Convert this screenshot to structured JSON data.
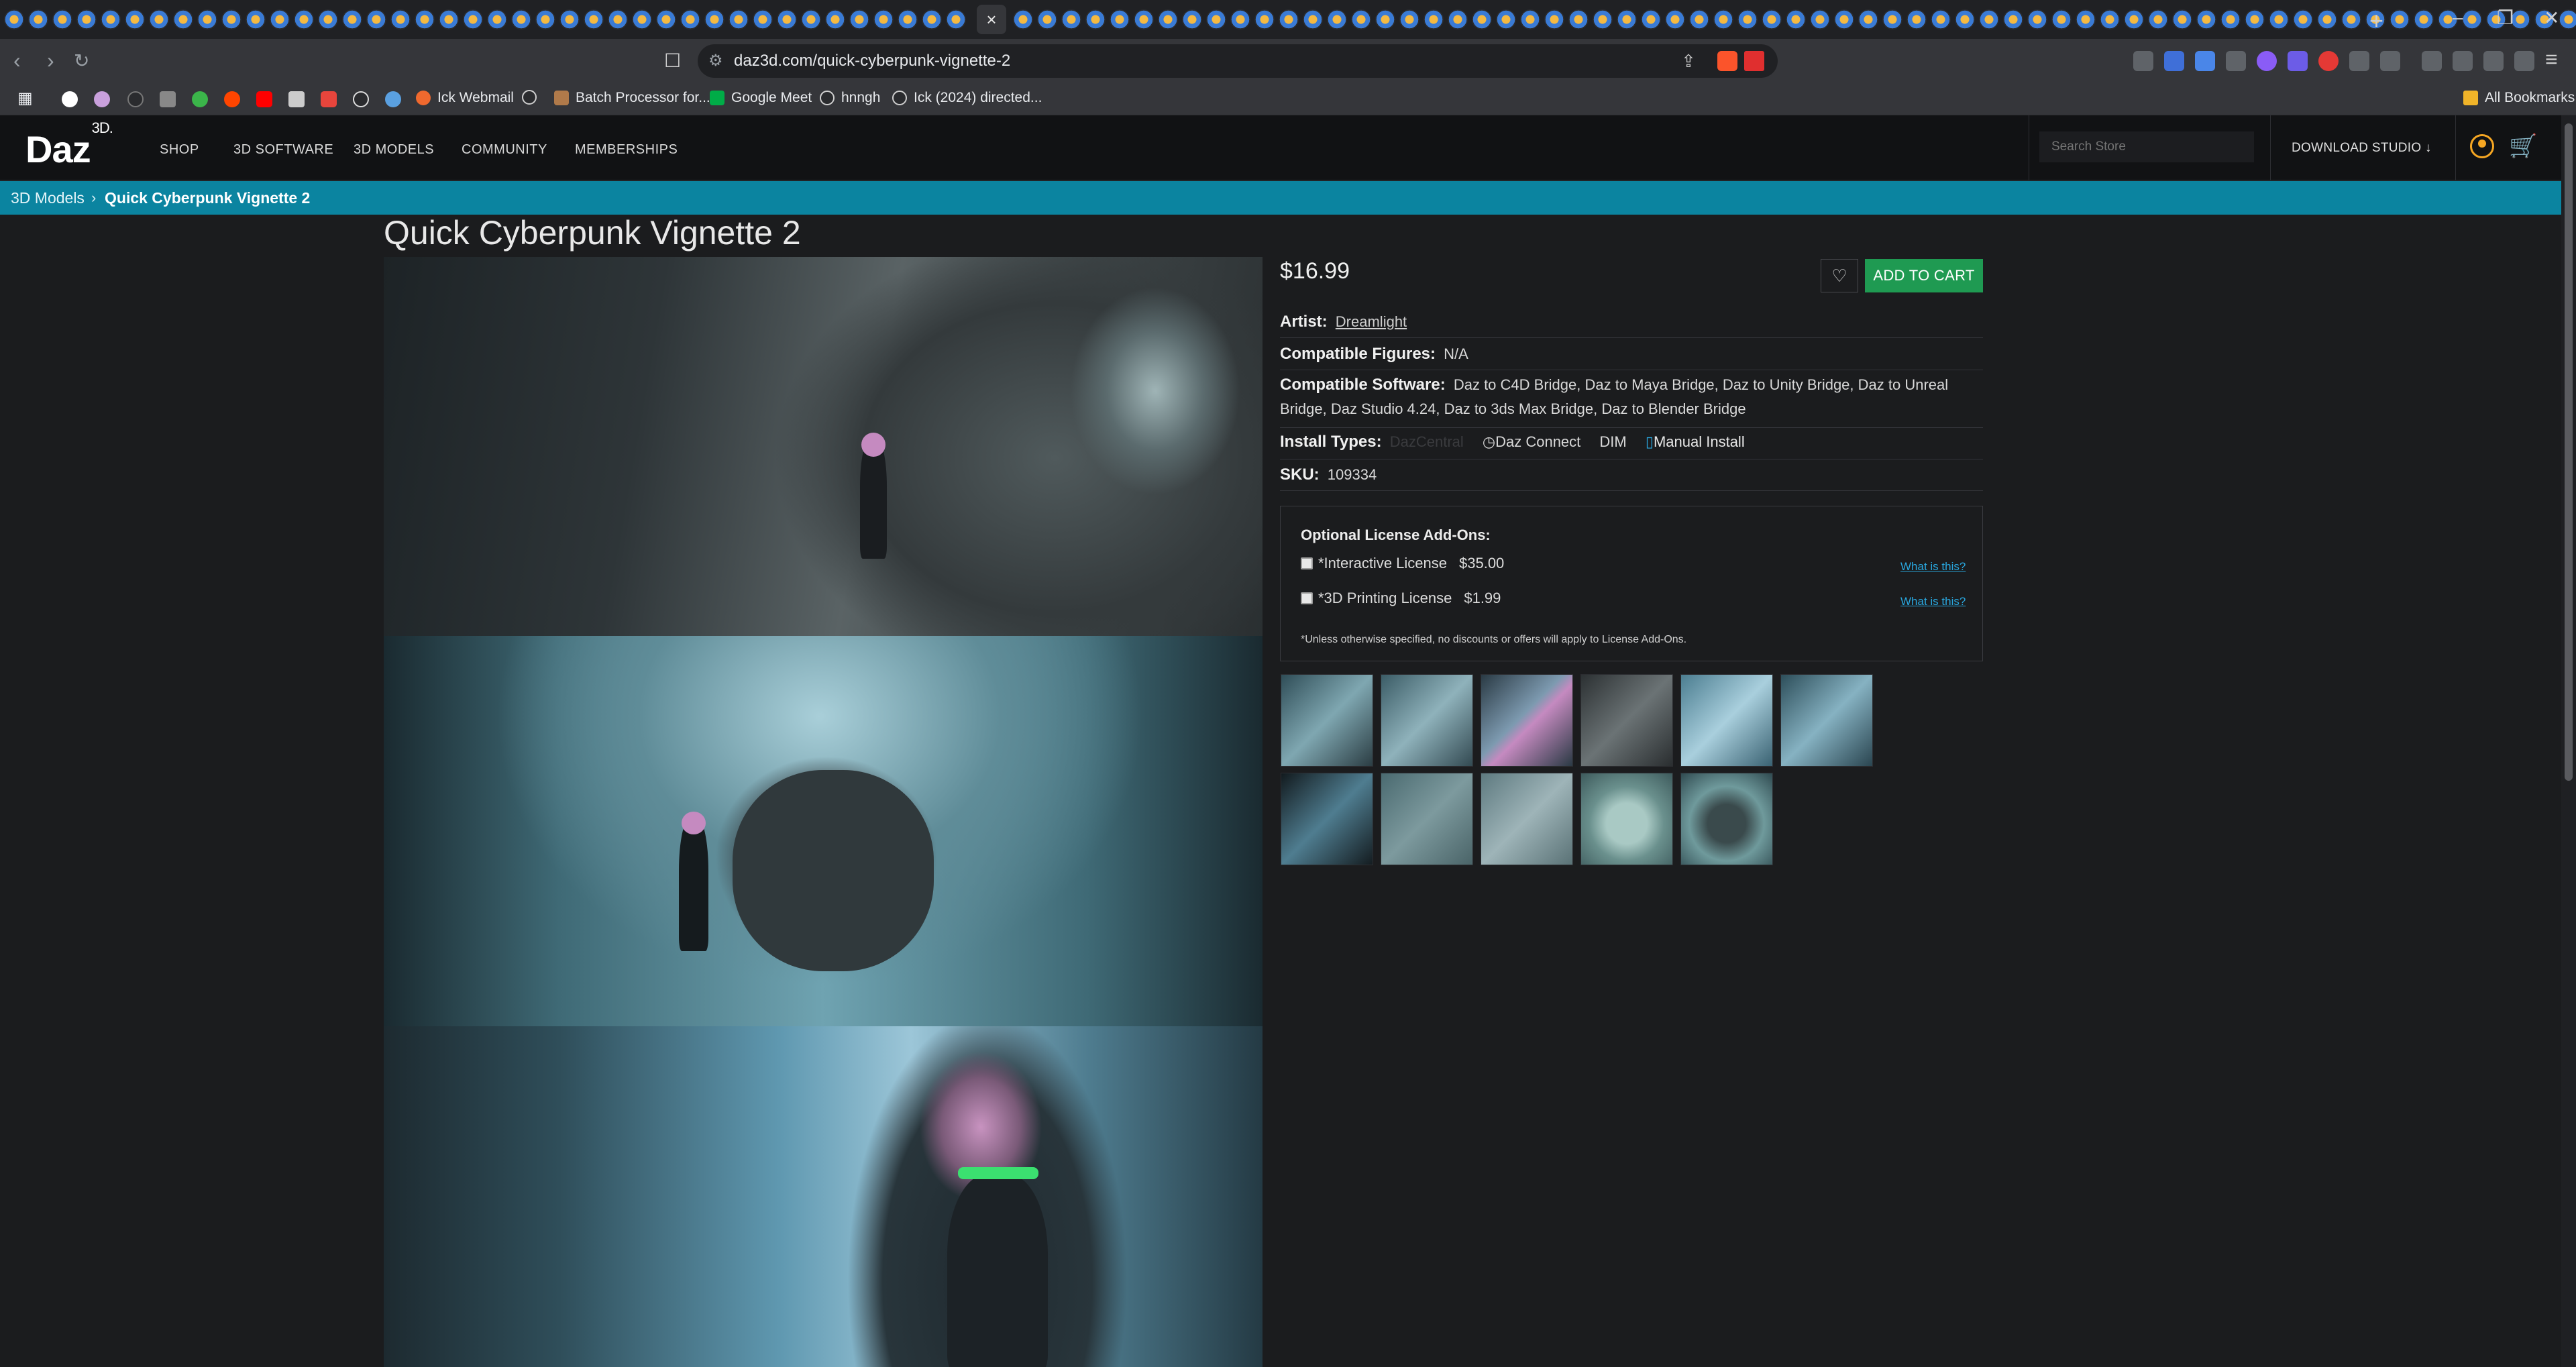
{
  "browser": {
    "url": "daz3d.com/quick-cyberpunk-vignette-2",
    "tab_close": "×",
    "new_tab": "+",
    "bookmarks": [
      {
        "label": "Ick Webmail"
      },
      {
        "label": "Batch Processor for..."
      },
      {
        "label": "Google Meet"
      },
      {
        "label": "hnngh"
      },
      {
        "label": "Ick (2024) directed..."
      }
    ],
    "all_bookmarks": "All Bookmarks"
  },
  "header": {
    "logo": "Daz",
    "logo_sup": "3D.",
    "nav": [
      "SHOP",
      "3D SOFTWARE",
      "3D MODELS",
      "COMMUNITY",
      "MEMBERSHIPS"
    ],
    "search_placeholder": "Search Store",
    "download_studio": "DOWNLOAD STUDIO ↓"
  },
  "breadcrumb": {
    "parent": "3D Models",
    "separator": "›",
    "current": "Quick Cyberpunk Vignette 2"
  },
  "product": {
    "title": "Quick Cyberpunk Vignette 2",
    "price": "$16.99",
    "add_to_cart": "ADD TO CART",
    "wishlist_icon": "♡",
    "artist_label": "Artist:",
    "artist": "Dreamlight",
    "figures_label": "Compatible Figures:",
    "figures": "N/A",
    "software_label": "Compatible Software:",
    "software": "Daz to C4D Bridge, Daz to Maya Bridge, Daz to Unity Bridge, Daz to Unreal Bridge, Daz Studio 4.24, Daz to 3ds Max Bridge, Daz to Blender Bridge",
    "install_label": "Install Types:",
    "install_types": {
      "dazcentral": "DazCentral",
      "daz_connect": "Daz Connect",
      "dim": "DIM",
      "manual": "Manual Install"
    },
    "sku_label": "SKU:",
    "sku": "109334"
  },
  "licenses": {
    "title": "Optional License Add-Ons:",
    "items": [
      {
        "name": "*Interactive License",
        "price": "$35.00",
        "link": "What is this?"
      },
      {
        "name": "*3D Printing License",
        "price": "$1.99",
        "link": "What is this?"
      }
    ],
    "note": "*Unless otherwise specified, no discounts or offers will apply to License Add-Ons."
  },
  "colors": {
    "accent_teal": "#0b84a0",
    "cart_green": "#1f9a52",
    "account_orange": "#f5a623",
    "link_blue": "#29a8e0"
  }
}
